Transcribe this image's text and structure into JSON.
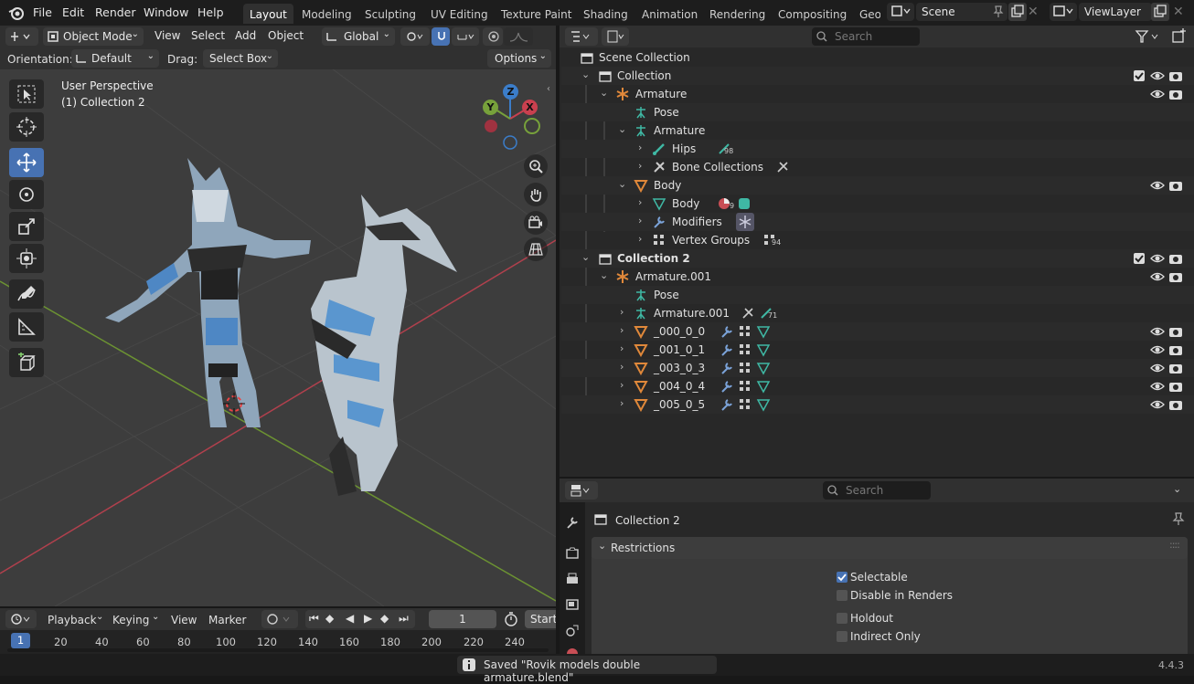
{
  "menu": {
    "file": "File",
    "edit": "Edit",
    "render": "Render",
    "window": "Window",
    "help": "Help"
  },
  "workspaces": [
    "Layout",
    "Modeling",
    "Sculpting",
    "UV Editing",
    "Texture Paint",
    "Shading",
    "Animation",
    "Rendering",
    "Compositing",
    "Geo"
  ],
  "scene": {
    "name": "Scene",
    "view_layer": "ViewLayer"
  },
  "viewport": {
    "mode": "Object Mode",
    "view": "View",
    "select": "Select",
    "add": "Add",
    "object": "Object",
    "transform": "Global",
    "orientation_label": "Orientation:",
    "orientation_value": "Default",
    "drag_label": "Drag:",
    "drag_value": "Select Box",
    "options": "Options",
    "perspective": "User Perspective",
    "active": "(1) Collection 2",
    "gizmo": {
      "z": "Z",
      "y": "Y",
      "x": "X"
    }
  },
  "outliner": {
    "search_placeholder": "Search",
    "rows": [
      {
        "label": "Scene Collection",
        "count": ""
      },
      {
        "label": "Collection",
        "count": ""
      },
      {
        "label": "Armature",
        "count": ""
      },
      {
        "label": "Pose",
        "count": ""
      },
      {
        "label": "Armature",
        "count": ""
      },
      {
        "label": "Hips",
        "count": "98"
      },
      {
        "label": "Bone Collections",
        "count": ""
      },
      {
        "label": "Body",
        "count": ""
      },
      {
        "label": "Body",
        "count": "9"
      },
      {
        "label": "Modifiers",
        "count": ""
      },
      {
        "label": "Vertex Groups",
        "count": "94"
      },
      {
        "label": "Collection 2",
        "count": ""
      },
      {
        "label": "Armature.001",
        "count": ""
      },
      {
        "label": "Pose",
        "count": ""
      },
      {
        "label": "Armature.001",
        "count": "71"
      },
      {
        "label": "_000_0_0",
        "count": ""
      },
      {
        "label": "_001_0_1",
        "count": ""
      },
      {
        "label": "_003_0_3",
        "count": ""
      },
      {
        "label": "_004_0_4",
        "count": ""
      },
      {
        "label": "_005_0_5",
        "count": ""
      }
    ]
  },
  "properties": {
    "search_placeholder": "Search",
    "title": "Collection 2",
    "section": "Restrictions",
    "selectable": "Selectable",
    "disable_renders": "Disable in Renders",
    "holdout": "Holdout",
    "indirect_only": "Indirect Only"
  },
  "timeline": {
    "playback": "Playback",
    "keying": "Keying",
    "view": "View",
    "marker": "Marker",
    "frame": "1",
    "start": "Start",
    "current": "1",
    "ticks": [
      "20",
      "40",
      "60",
      "80",
      "100",
      "120",
      "140",
      "160",
      "180",
      "200",
      "220",
      "240"
    ]
  },
  "status": {
    "message": "Saved \"Rovik models double armature.blend\"",
    "version": "4.4.3"
  },
  "colors": {
    "accent": "#4772b3",
    "x_axis": "#c9404f",
    "y_axis": "#77a13b",
    "z_axis": "#3b7dc9"
  }
}
